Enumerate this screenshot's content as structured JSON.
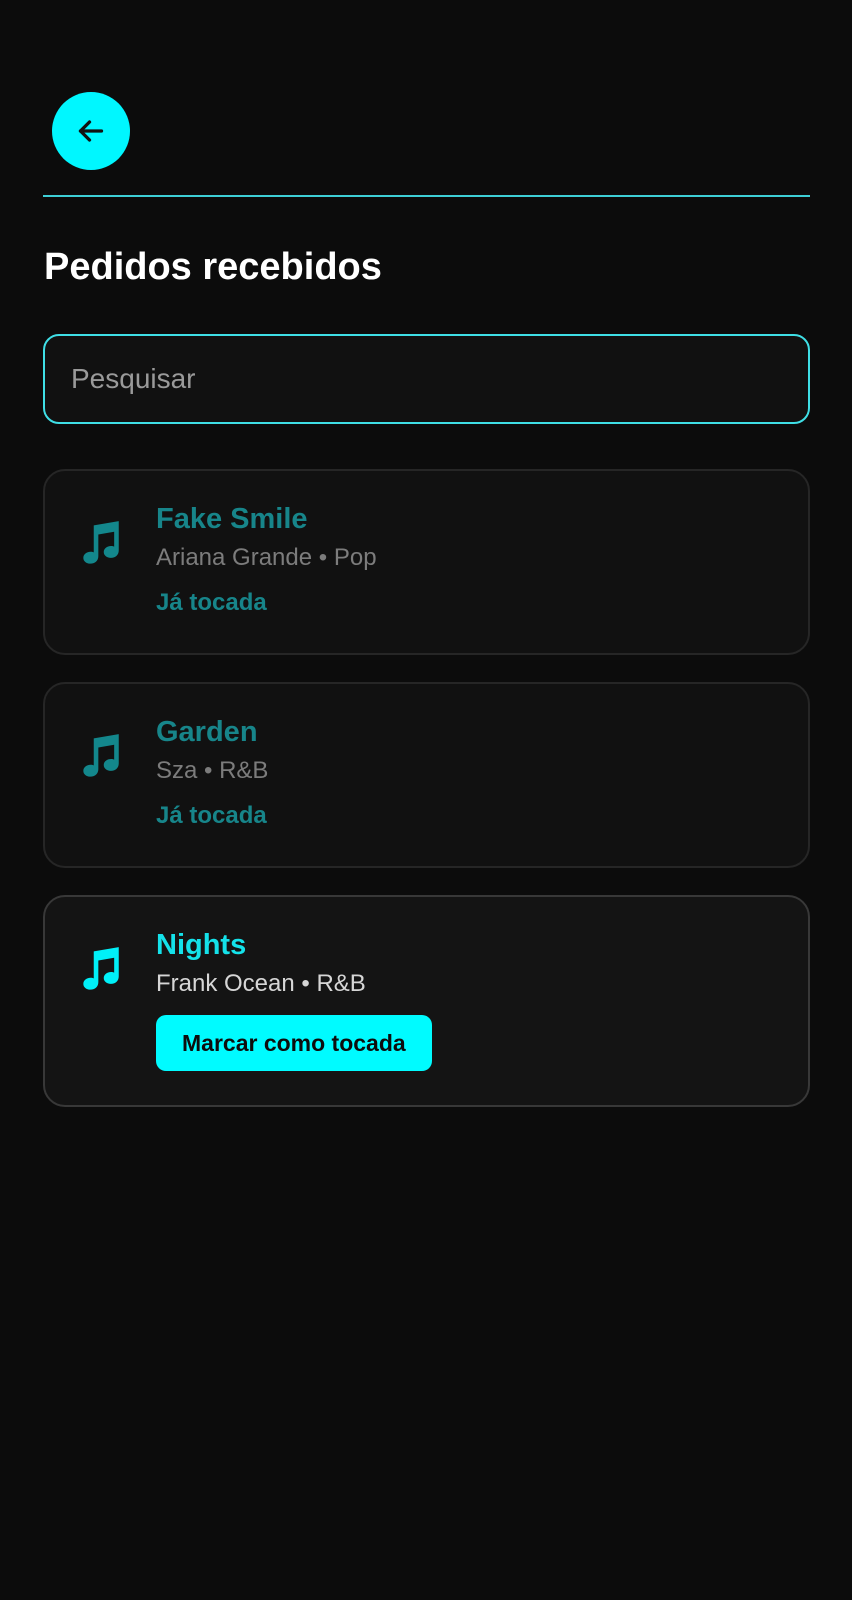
{
  "header": {
    "back_icon": "arrow-left-icon",
    "accent_color": "#00f7ff"
  },
  "page": {
    "title": "Pedidos recebidos"
  },
  "search": {
    "placeholder": "Pesquisar",
    "value": ""
  },
  "requests": [
    {
      "title": "Fake Smile",
      "meta": "Ariana Grande • Pop",
      "status": "Já tocada",
      "icon": "music-note-icon",
      "color": "#17858a"
    },
    {
      "title": "Garden",
      "meta": "Sza • R&B",
      "status": "Já tocada",
      "icon": "music-note-icon",
      "color": "#17858a"
    },
    {
      "title": "Nights",
      "meta": "Frank Ocean • R&B",
      "action_label": "Marcar como tocada",
      "icon": "music-note-icon",
      "color": "#14e2ea"
    }
  ]
}
